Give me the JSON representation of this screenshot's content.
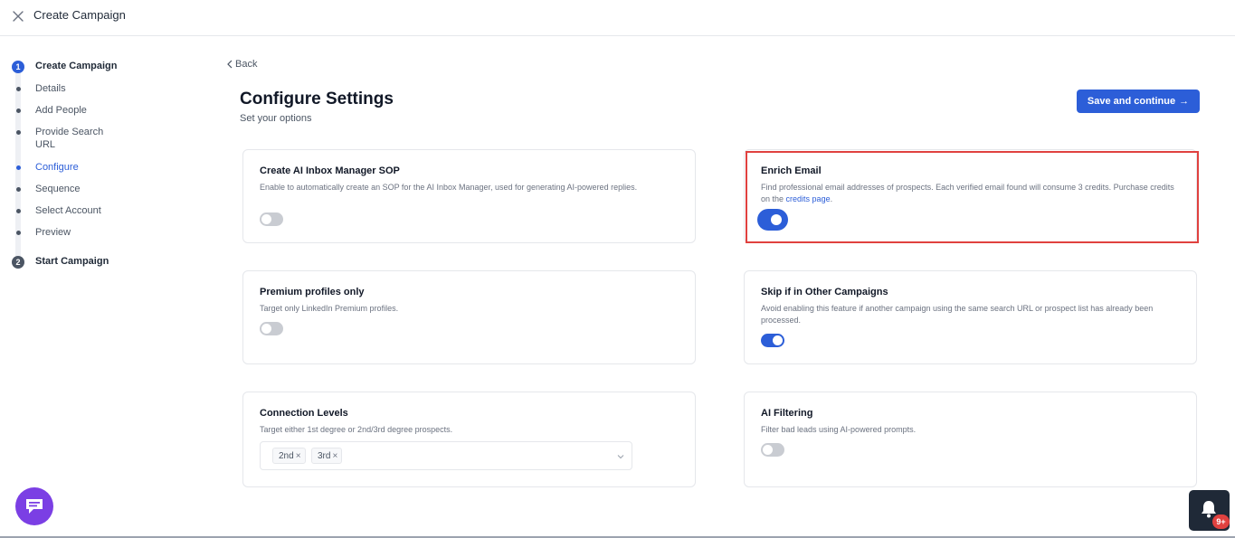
{
  "header": {
    "title": "Create Campaign"
  },
  "stepper": {
    "step1": {
      "number": "1",
      "label": "Create Campaign"
    },
    "substeps": [
      {
        "label": "Details",
        "active": false
      },
      {
        "label": "Add People",
        "active": false
      },
      {
        "label": "Provide Search URL",
        "active": false
      },
      {
        "label": "Configure",
        "active": true
      },
      {
        "label": "Sequence",
        "active": false
      },
      {
        "label": "Select Account",
        "active": false
      },
      {
        "label": "Preview",
        "active": false
      }
    ],
    "step2": {
      "number": "2",
      "label": "Start Campaign"
    }
  },
  "main": {
    "back_label": "Back",
    "title": "Configure Settings",
    "subtitle": "Set your options",
    "save_label": "Save and continue",
    "save_arrow": "→"
  },
  "settings": {
    "ai_inbox": {
      "title": "Create AI Inbox Manager SOP",
      "description": "Enable to automatically create an SOP for the AI Inbox Manager, used for generating AI-powered replies.",
      "enabled": false
    },
    "enrich_email": {
      "title": "Enrich Email",
      "description": "Find professional email addresses of prospects. Each verified email found will consume 3 credits. Purchase credits on the",
      "link_text": "credits page",
      "link_suffix": ".",
      "enabled": true
    },
    "premium": {
      "title": "Premium profiles only",
      "description": "Target only LinkedIn Premium profiles.",
      "enabled": false
    },
    "skip_other": {
      "title": "Skip if in Other Campaigns",
      "description": "Avoid enabling this feature if another campaign using the same search URL or prospect list has already been processed.",
      "enabled": true
    },
    "connection_levels": {
      "title": "Connection Levels",
      "description": "Target either 1st degree or 2nd/3rd degree prospects.",
      "selected": [
        "2nd",
        "3rd"
      ]
    },
    "ai_filtering": {
      "title": "AI Filtering",
      "description": "Filter bad leads using AI-powered prompts.",
      "enabled": false
    }
  },
  "notifications": {
    "badge": "9+"
  },
  "colors": {
    "accent": "#2c5ed8",
    "highlight": "#e0413f",
    "chat": "#7b3fe4",
    "notif_bg": "#1f2937"
  }
}
